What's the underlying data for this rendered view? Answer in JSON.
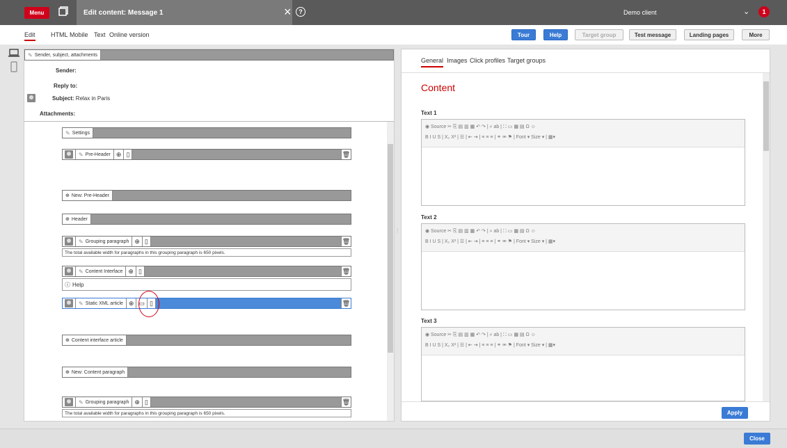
{
  "topbar": {
    "menu_label": "Menu",
    "title": "Edit content: Message 1",
    "close_glyph": "×",
    "help_glyph": "?",
    "client": "Demo client",
    "chevron": "⌄",
    "notification_count": "1"
  },
  "nav": {
    "tabs": [
      "Edit",
      "HTML",
      "Mobile",
      "Text",
      "Online version"
    ],
    "buttons": {
      "tour": "Tour",
      "help": "Help",
      "target_group": "Target group",
      "test_message": "Test message",
      "landing_pages": "Landing pages",
      "more": "More"
    }
  },
  "left": {
    "header_label": "Sender, subject, attachments",
    "sender_label": "Sender:",
    "reply_label": "Reply to:",
    "subject_label": "Subject:",
    "subject_value": "Relax in Paris",
    "attachments_label": "Attachments:",
    "blocks": {
      "settings": "Settings",
      "preheader": "Pre-Header",
      "new_preheader": "New: Pre-Header",
      "header": "Header",
      "grouping1": "Grouping paragraph",
      "grouping1_note": "The total available width for paragraphs in this grouping paragraph is 650 pixels.",
      "content_interface": "Content Interface",
      "help": "Help",
      "static_xml": "Static XML article",
      "ci_article": "Content interface article",
      "new_content_paragraph": "New: Content paragraph",
      "grouping2": "Grouping paragraph",
      "grouping2_note": "The total available width for paragraphs in this grouping paragraph is 650 pixels."
    }
  },
  "right": {
    "tabs": [
      "General",
      "Images",
      "Click profiles",
      "Target groups"
    ],
    "heading": "Content",
    "editors": [
      "Text 1",
      "Text 2",
      "Text 3"
    ],
    "toolbar_row1": "◉ Source   ✂ ⎘ ▤ ▥ ▦ ↶ ↷ | ⌕ ab | ⛶ ▭ ▦ ▤ Ω ☺",
    "toolbar_row2": "B  I  U  S | X₂ X² | ☰ | ⇤ ⇥ | ≡ ≡ ≡ | ⚭ ⚮ ⚑ | Font ▾  Size ▾ | ▦▾",
    "apply": "Apply"
  },
  "bottom": {
    "close": "Close"
  },
  "colors": {
    "brand_red": "#d0021b",
    "primary_blue": "#3a7bd5",
    "selected_row": "#4a8ad8"
  }
}
